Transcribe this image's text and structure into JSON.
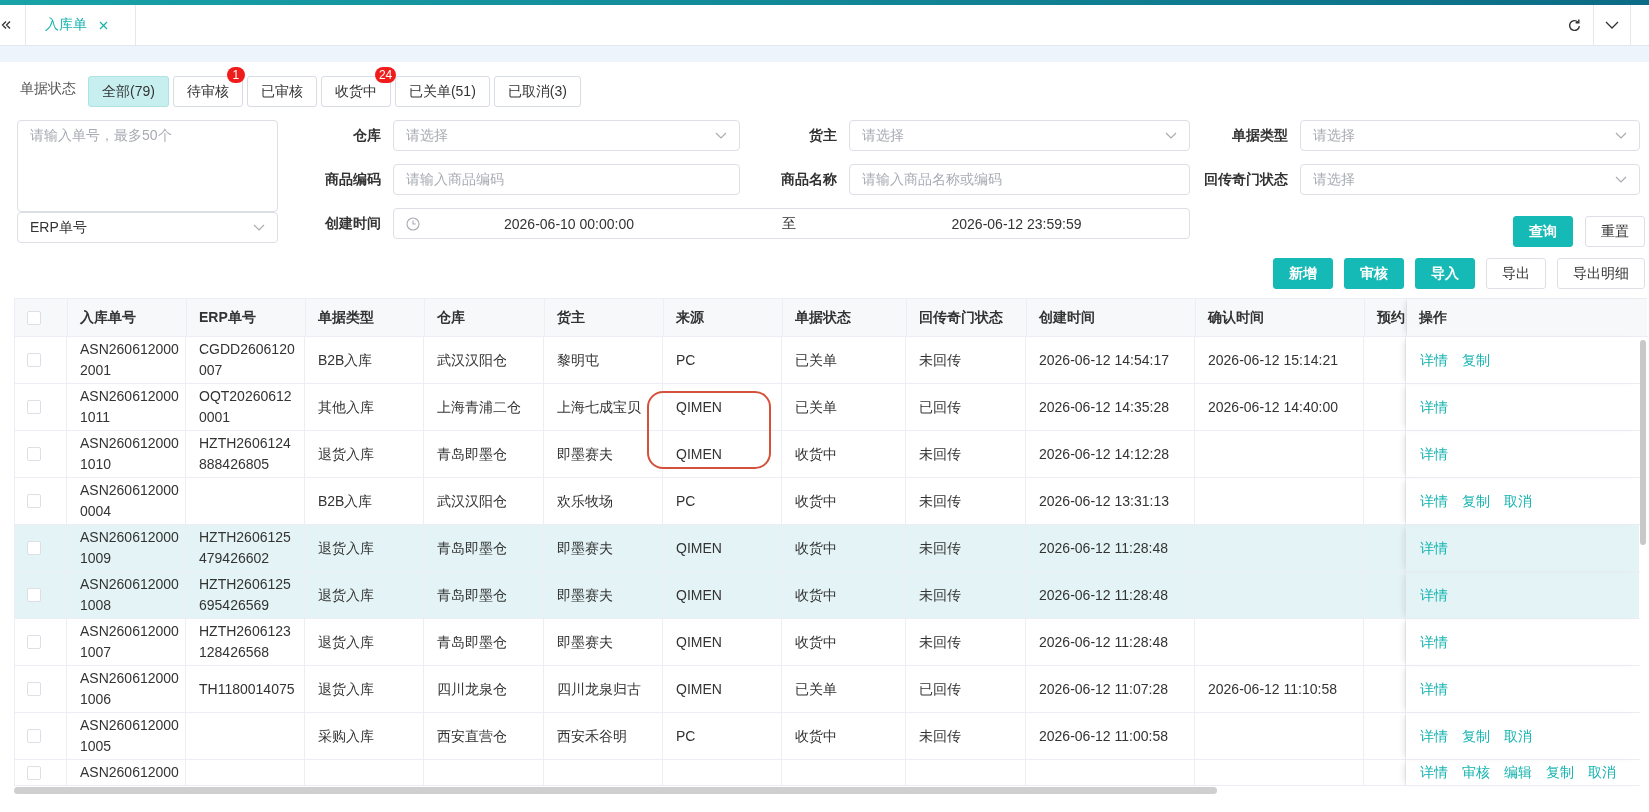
{
  "top_tabs": [
    {
      "label": "入库单",
      "selected": true
    }
  ],
  "status_filter": {
    "label": "单据状态",
    "tabs": [
      {
        "label": "全部(79)",
        "selected": true
      },
      {
        "label": "待审核",
        "badge": "1",
        "selected": false
      },
      {
        "label": "已审核",
        "selected": false
      },
      {
        "label": "收货中",
        "badge": "24",
        "selected": false
      },
      {
        "label": "已关单(51)",
        "selected": false
      },
      {
        "label": "已取消(3)",
        "selected": false
      }
    ]
  },
  "filters": {
    "order_numbers": {
      "placeholder": "请输入单号，最多50个"
    },
    "number_type": {
      "value": "ERP单号"
    },
    "fields": [
      {
        "label": "仓库",
        "kind": "select",
        "placeholder": "请选择"
      },
      {
        "label": "货主",
        "kind": "select",
        "placeholder": "请选择"
      },
      {
        "label": "单据类型",
        "kind": "select",
        "placeholder": "请选择"
      },
      {
        "label": "商品编码",
        "kind": "input",
        "placeholder": "请输入商品编码"
      },
      {
        "label": "商品名称",
        "kind": "input",
        "placeholder": "请输入商品名称或编码"
      },
      {
        "label": "回传奇门状态",
        "kind": "select",
        "placeholder": "请选择"
      }
    ],
    "created": {
      "label": "创建时间",
      "start": "2026-06-10 00:00:00",
      "separator": "至",
      "end": "2026-06-12 23:59:59"
    },
    "buttons": [
      {
        "label": "查询",
        "kind": "primary"
      },
      {
        "label": "重置",
        "kind": "default"
      }
    ]
  },
  "toolbar": {
    "buttons": [
      {
        "label": "新增",
        "kind": "primary"
      },
      {
        "label": "审核",
        "kind": "primary"
      },
      {
        "label": "导入",
        "kind": "primary"
      },
      {
        "label": "导出",
        "kind": "default"
      },
      {
        "label": "导出明细",
        "kind": "default"
      }
    ]
  },
  "table": {
    "select_all": {
      "checked": false
    },
    "columns": [
      "入库单号",
      "ERP单号",
      "单据类型",
      "仓库",
      "货主",
      "来源",
      "单据状态",
      "回传奇门状态",
      "创建时间",
      "确认时间",
      "预约",
      "操作"
    ],
    "rows": [
      {
        "checked": false,
        "highlighted": false,
        "circled": false,
        "order_no": "ASN2606120002001",
        "erp_no": "CGDD2606120007",
        "type": "B2B入库",
        "warehouse": "武汉汉阳仓",
        "owner": "黎明屯",
        "source": "PC",
        "status": "已关单",
        "qimen_status": "未回传",
        "created_at": "2026-06-12 14:54:17",
        "confirmed_at": "2026-06-12 15:14:21",
        "actions": [
          "详情",
          "复制"
        ]
      },
      {
        "checked": false,
        "highlighted": false,
        "circled": true,
        "order_no": "ASN2606120001011",
        "erp_no": "OQT202606120001",
        "type": "其他入库",
        "warehouse": "上海青浦二仓",
        "owner": "上海七成宝贝",
        "source": "QIMEN",
        "status": "已关单",
        "qimen_status": "已回传",
        "created_at": "2026-06-12 14:35:28",
        "confirmed_at": "2026-06-12 14:40:00",
        "actions": [
          "详情"
        ]
      },
      {
        "checked": false,
        "highlighted": false,
        "circled": true,
        "order_no": "ASN2606120001010",
        "erp_no": "HZTH2606124888426805",
        "type": "退货入库",
        "warehouse": "青岛即墨仓",
        "owner": "即墨赛夫",
        "source": "QIMEN",
        "status": "收货中",
        "qimen_status": "未回传",
        "created_at": "2026-06-12 14:12:28",
        "actions": [
          "详情"
        ]
      },
      {
        "checked": false,
        "highlighted": false,
        "circled": false,
        "order_no": "ASN2606120000004",
        "type": "B2B入库",
        "warehouse": "武汉汉阳仓",
        "owner": "欢乐牧场",
        "source": "PC",
        "status": "收货中",
        "qimen_status": "未回传",
        "created_at": "2026-06-12 13:31:13",
        "actions": [
          "详情",
          "复制",
          "取消"
        ]
      },
      {
        "checked": false,
        "highlighted": true,
        "circled": false,
        "order_no": "ASN2606120001009",
        "erp_no": "HZTH2606125479426602",
        "type": "退货入库",
        "warehouse": "青岛即墨仓",
        "owner": "即墨赛夫",
        "source": "QIMEN",
        "status": "收货中",
        "qimen_status": "未回传",
        "created_at": "2026-06-12 11:28:48",
        "actions": [
          "详情"
        ]
      },
      {
        "checked": false,
        "highlighted": true,
        "circled": false,
        "order_no": "ASN2606120001008",
        "erp_no": "HZTH2606125695426569",
        "type": "退货入库",
        "warehouse": "青岛即墨仓",
        "owner": "即墨赛夫",
        "source": "QIMEN",
        "status": "收货中",
        "qimen_status": "未回传",
        "created_at": "2026-06-12 11:28:48",
        "actions": [
          "详情"
        ]
      },
      {
        "checked": false,
        "highlighted": false,
        "circled": false,
        "order_no": "ASN2606120001007",
        "erp_no": "HZTH2606123128426568",
        "type": "退货入库",
        "warehouse": "青岛即墨仓",
        "owner": "即墨赛夫",
        "source": "QIMEN",
        "status": "收货中",
        "qimen_status": "未回传",
        "created_at": "2026-06-12 11:28:48",
        "actions": [
          "详情"
        ]
      },
      {
        "checked": false,
        "highlighted": false,
        "circled": false,
        "order_no": "ASN2606120001006",
        "erp_no": "TH1180014075",
        "type": "退货入库",
        "warehouse": "四川龙泉仓",
        "owner": "四川龙泉归古",
        "source": "QIMEN",
        "status": "已关单",
        "qimen_status": "已回传",
        "created_at": "2026-06-12 11:07:28",
        "confirmed_at": "2026-06-12 11:10:58",
        "actions": [
          "详情"
        ]
      },
      {
        "checked": false,
        "highlighted": false,
        "circled": false,
        "order_no": "ASN2606120001005",
        "type": "采购入库",
        "warehouse": "西安直营仓",
        "owner": "西安禾谷明",
        "source": "PC",
        "status": "收货中",
        "qimen_status": "未回传",
        "created_at": "2026-06-12 11:00:58",
        "actions": [
          "详情",
          "复制",
          "取消"
        ]
      },
      {
        "checked": false,
        "highlighted": false,
        "circled": false,
        "order_no": "ASN260612000",
        "actions": [
          "详情",
          "审核",
          "编辑",
          "复制",
          "取消"
        ]
      }
    ]
  }
}
